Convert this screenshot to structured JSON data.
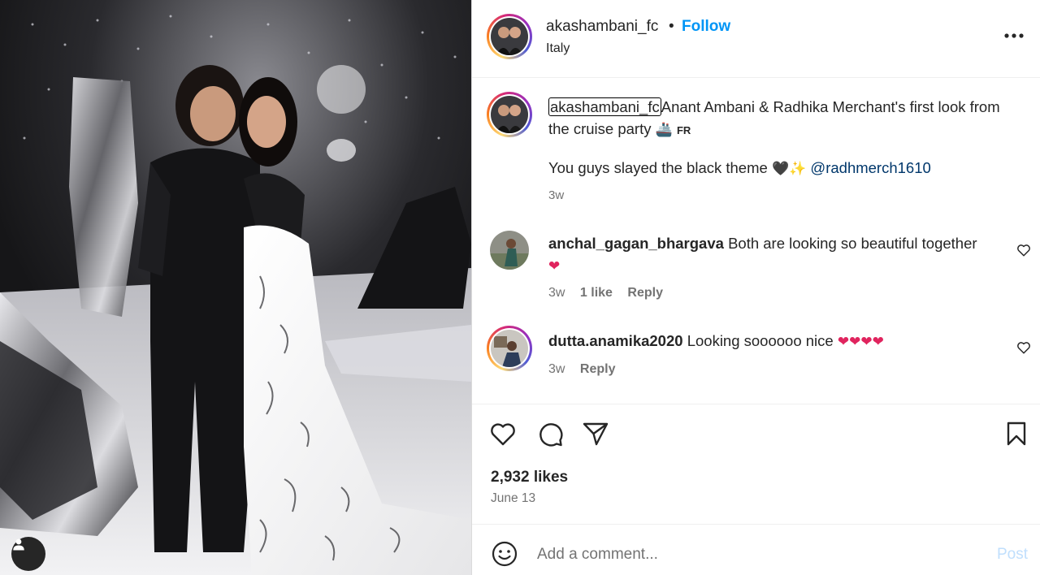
{
  "header": {
    "username": "akashambani_fc",
    "separator": "•",
    "follow_label": "Follow",
    "location": "Italy"
  },
  "caption": {
    "username": "akashambani_fc",
    "text": "Anant Ambani & Radhika Merchant's first look from the cruise party",
    "flag_text": "FR",
    "line2_text": "You guys slayed the black theme",
    "mention": "@radhmerch1610",
    "time": "3w"
  },
  "comments": [
    {
      "username": "anchal_gagan_bhargava",
      "text": "Both are looking so beautiful together",
      "time": "3w",
      "likes": "1 like",
      "reply_label": "Reply"
    },
    {
      "username": "dutta.anamika2020",
      "text": "Looking soooooo nice",
      "time": "3w",
      "reply_label": "Reply"
    }
  ],
  "actions": {
    "like_icon": "heart-icon",
    "comment_icon": "comment-bubble-icon",
    "share_icon": "paper-plane-icon",
    "save_icon": "bookmark-icon"
  },
  "stats": {
    "likes": "2,932 likes",
    "date": "June 13"
  },
  "comment_box": {
    "placeholder": "Add a comment...",
    "post_label": "Post"
  },
  "colors": {
    "follow": "#0095f6",
    "mention": "#00376b",
    "muted": "#737373",
    "post_disabled": "#c0dffd",
    "heart_red": "#e0245e"
  }
}
